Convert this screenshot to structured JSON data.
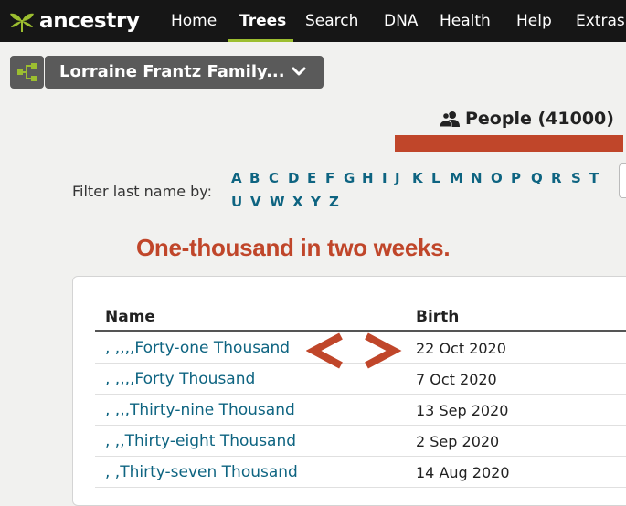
{
  "nav": {
    "logo_text": "ancestry",
    "items": [
      {
        "label": "Home",
        "active": false
      },
      {
        "label": "Trees",
        "active": true
      },
      {
        "label": "Search",
        "active": false
      },
      {
        "label": "DNA",
        "active": false
      },
      {
        "label": "Health",
        "active": false
      },
      {
        "label": "Help",
        "active": false
      },
      {
        "label": "Extras",
        "active": false
      }
    ]
  },
  "tree_selector": {
    "label": "Lorraine Frantz Family..."
  },
  "people_count": "People (41000)",
  "filter": {
    "label": "Filter last name by:",
    "letters_row1": [
      "A",
      "B",
      "C",
      "D",
      "E",
      "F",
      "G",
      "H",
      "I",
      "J",
      "K",
      "L",
      "M",
      "N",
      "O",
      "P",
      "Q",
      "R",
      "S",
      "T"
    ],
    "letters_row2": [
      "U",
      "V",
      "W",
      "X",
      "Y",
      "Z"
    ]
  },
  "annotation": "One-thousand in two weeks.",
  "table": {
    "headers": {
      "name": "Name",
      "birth": "Birth"
    },
    "rows": [
      {
        "name": ", ,,,,Forty-one Thousand",
        "birth": "22 Oct 2020"
      },
      {
        "name": ", ,,,,Forty Thousand",
        "birth": "7 Oct 2020"
      },
      {
        "name": ", ,,,Thirty-nine Thousand",
        "birth": "13 Sep 2020"
      },
      {
        "name": ", ,,Thirty-eight Thousand",
        "birth": "2 Sep 2020"
      },
      {
        "name": ", ,Thirty-seven Thousand",
        "birth": "14 Aug 2020"
      }
    ]
  },
  "colors": {
    "nav_bg": "#161616",
    "accent_green": "#9cbe30",
    "link_teal": "#0e6481",
    "annotation_red": "#c0462a",
    "button_gray": "#5a5a5a"
  }
}
